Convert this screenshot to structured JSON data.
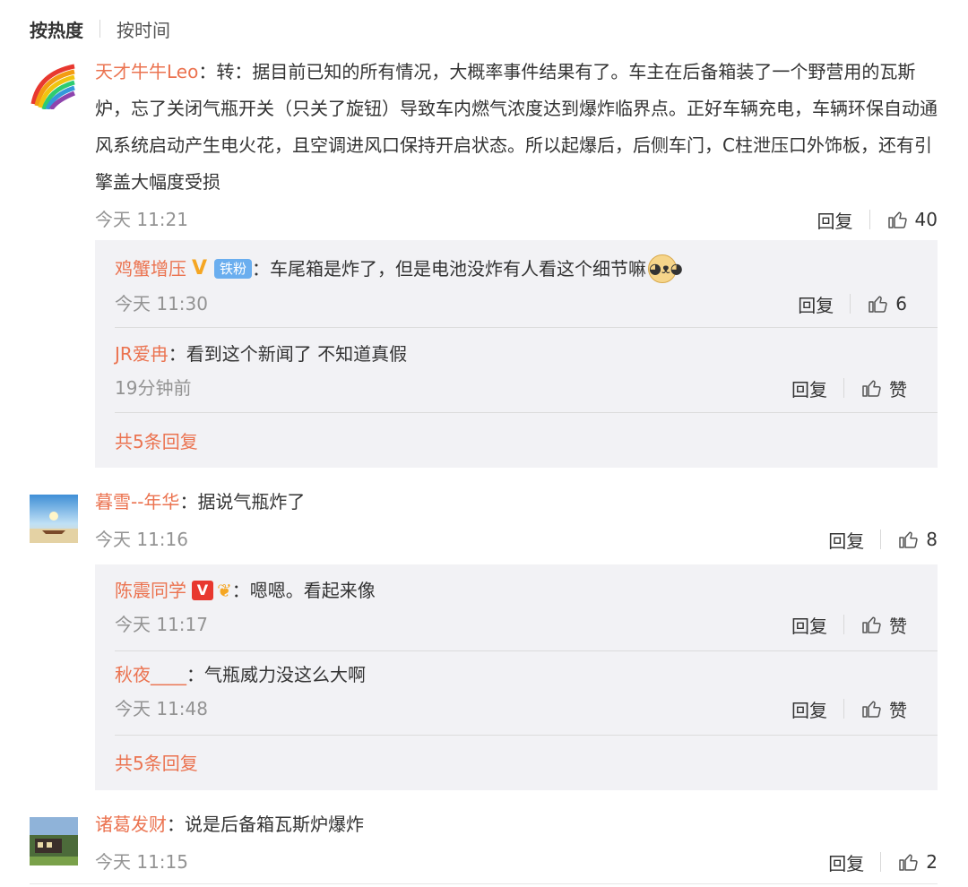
{
  "sort": {
    "hot": "按热度",
    "time": "按时间"
  },
  "comments": [
    {
      "user": "天才牛牛Leo",
      "text": "转：据目前已知的所有情况，大概率事件结果有了。车主在后备箱装了一个野营用的瓦斯炉，忘了关闭气瓶开关（只关了旋钮）导致车内燃气浓度达到爆炸临界点。正好车辆充电，车辆环保自动通风系统启动产生电火花，且空调进风口保持开启状态。所以起爆后，后侧车门，C柱泄压口外饰板，还有引擎盖大幅度受损",
      "time": "今天 11:21",
      "reply_label": "回复",
      "likes": "40",
      "replies": [
        {
          "user": "鸡蟹增压",
          "badge_fans": "铁粉",
          "text": "车尾箱是炸了，但是电池没炸有人看这个细节嘛",
          "time": "今天 11:30",
          "reply_label": "回复",
          "likes": "6"
        },
        {
          "user": "JR爱冉",
          "text": "看到这个新闻了 不知道真假",
          "time": "19分钟前",
          "reply_label": "回复",
          "likes": "赞"
        }
      ],
      "more": "共5条回复"
    },
    {
      "user": "暮雪--年华",
      "text": "据说气瓶炸了",
      "time": "今天 11:16",
      "reply_label": "回复",
      "likes": "8",
      "replies": [
        {
          "user": "陈震同学",
          "badge_v": "V",
          "text": "嗯嗯。看起来像",
          "time": "今天 11:17",
          "reply_label": "回复",
          "likes": "赞"
        },
        {
          "user": "秋夜____",
          "text": "气瓶威力没这么大啊",
          "time": "今天 11:48",
          "reply_label": "回复",
          "likes": "赞"
        }
      ],
      "more": "共5条回复"
    },
    {
      "user": "诸葛发财",
      "text": "说是后备箱瓦斯炉爆炸",
      "time": "今天 11:15",
      "reply_label": "回复",
      "likes": "2"
    }
  ],
  "colors": {
    "username": "#eb7350",
    "reply_bg": "#f2f2f5",
    "time": "#939393"
  },
  "icons": [
    "thumbs-up-icon",
    "v-badge-icon",
    "fans-badge",
    "doge-emoji",
    "flame-badge-icon"
  ]
}
